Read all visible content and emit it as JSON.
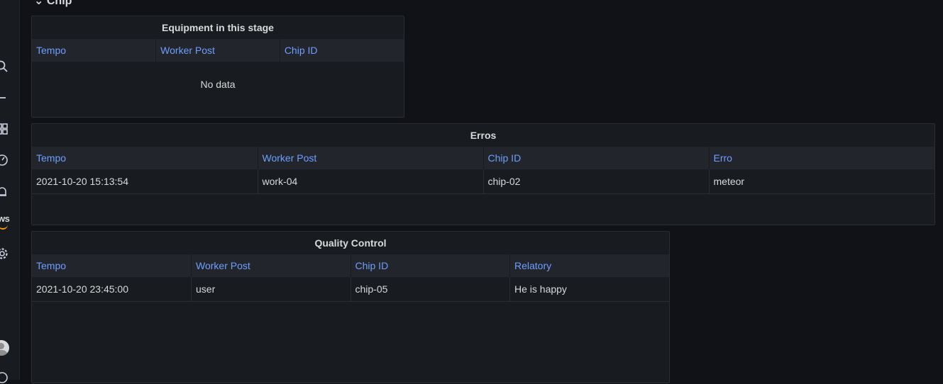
{
  "row": {
    "title": "Chip"
  },
  "sidebar": {
    "icons": [
      "search-icon",
      "plus-icon",
      "dashboards-icon",
      "explore-icon",
      "alerting-icon",
      "aws-icon",
      "gear-icon",
      "avatar",
      "help-icon"
    ],
    "aws_label": "ws"
  },
  "panels": {
    "equipment": {
      "title": "Equipment in this stage",
      "columns": [
        "Tempo",
        "Worker Post",
        "Chip ID"
      ],
      "empty_text": "No data"
    },
    "erros": {
      "title": "Erros",
      "columns": [
        "Tempo",
        "Worker Post",
        "Chip ID",
        "Erro"
      ],
      "rows": [
        [
          "2021-10-20 15:13:54",
          "work-04",
          "chip-02",
          "meteor"
        ]
      ]
    },
    "quality": {
      "title": "Quality Control",
      "columns": [
        "Tempo",
        "Worker Post",
        "Chip ID",
        "Relatory"
      ],
      "rows": [
        [
          "2021-10-20 23:45:00",
          "user",
          "chip-05",
          "He is happy"
        ]
      ]
    }
  },
  "colors": {
    "background": "#111217",
    "panel": "#181b1f",
    "header_bg": "#22252b",
    "header_text": "#6e9fff",
    "text": "#d8d9da"
  }
}
